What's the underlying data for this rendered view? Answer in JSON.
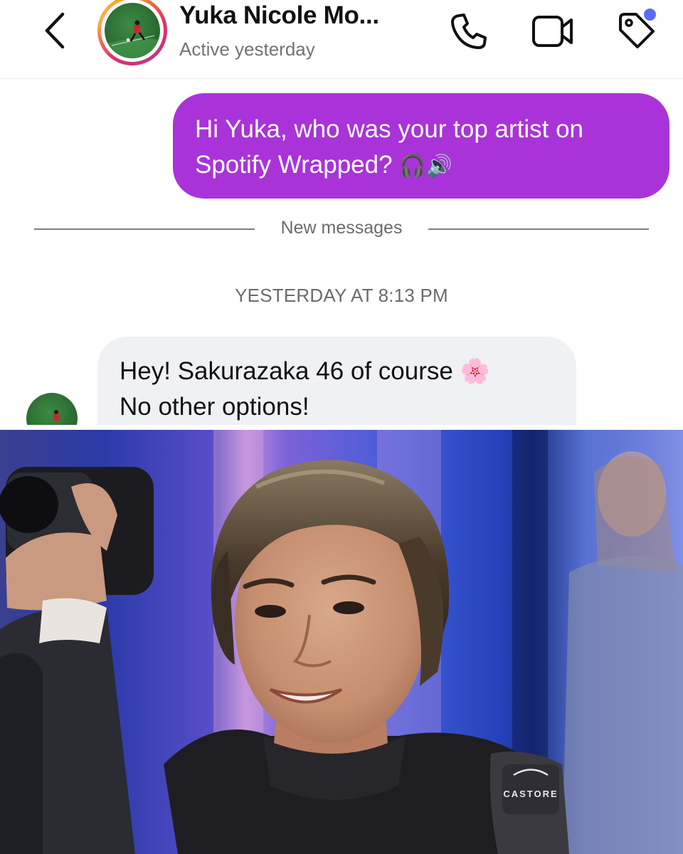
{
  "header": {
    "contact_name": "Yuka Nicole Mo...",
    "status": "Active yesterday",
    "back_icon": "chevron-left-icon",
    "call_icon": "phone-icon",
    "video_icon": "video-camera-icon",
    "tag_icon": "tag-icon",
    "badge_color": "#5b6cf6"
  },
  "conversation": {
    "outgoing": {
      "line1": "Hi Yuka, who was your top artist on",
      "line2": "Spotify Wrapped?",
      "emojis": "🎧🔊",
      "color": "#a933d8"
    },
    "divider_label": "New messages",
    "timestamp": "YESTERDAY AT 8:13 PM",
    "incoming": {
      "line1": "Hey! Sakurazaka 46 of course",
      "emoji": "🌸",
      "line2": "No other options!"
    }
  },
  "photo": {
    "backpack_brand": "CASTORE"
  }
}
